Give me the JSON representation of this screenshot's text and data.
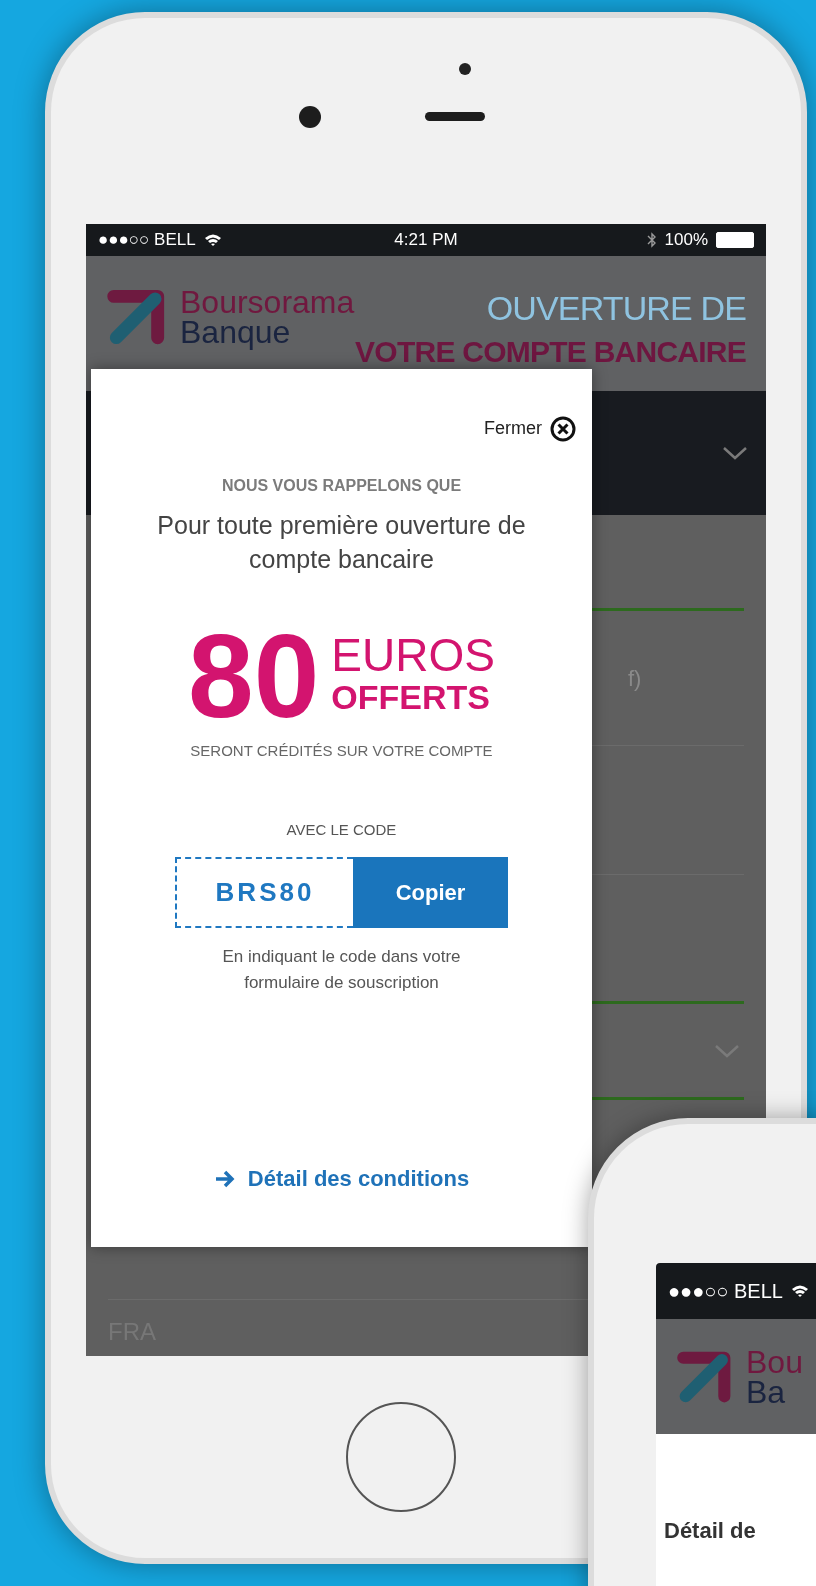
{
  "main_phone": {
    "status_bar": {
      "carrier": "●●●○○ BELL",
      "time": "4:21 PM",
      "battery": "100%"
    },
    "header": {
      "brand_line_1": "Boursorama",
      "brand_line_2": "Banque",
      "title_line_1": "OUVERTURE DE",
      "title_line_2": "VOTRE COMPTE BANCAIRE"
    },
    "background_texts": [
      "f)",
      "FRA"
    ],
    "modal": {
      "close_label": "Fermer",
      "kicker": "NOUS VOUS RAPPELONS QUE",
      "intro": "Pour toute première ouverture de compte bancaire",
      "amount": "80",
      "currency": "EUROS",
      "offered": "OFFERTS",
      "credited": "SERONT CRÉDITÉS SUR VOTRE COMPTE",
      "code_label": "AVEC LE CODE",
      "code": "BRS80",
      "copy_button": "Copier",
      "hint": "En indiquant le code dans votre formulaire de souscription",
      "link": "Détail des conditions"
    }
  },
  "second_phone": {
    "status_bar": {
      "carrier": "●●●○○ BELL"
    },
    "header": {
      "brand_line_1": "Bou",
      "brand_line_2": "Ba"
    },
    "content_title": "Détail de"
  }
}
